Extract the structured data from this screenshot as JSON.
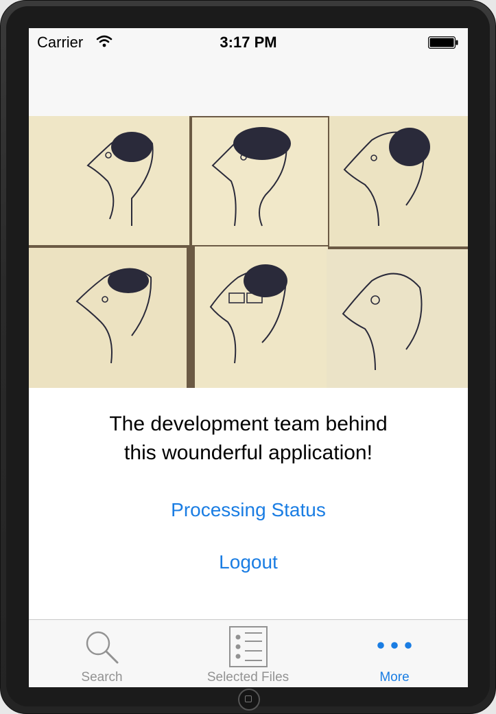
{
  "status_bar": {
    "carrier": "Carrier",
    "time": "3:17 PM"
  },
  "content": {
    "message_line1": "The development team behind",
    "message_line2": "this wounderful application!",
    "links": {
      "processing_status": "Processing Status",
      "logout": "Logout"
    }
  },
  "tab_bar": {
    "tabs": [
      {
        "label": "Search",
        "icon": "search-icon",
        "active": false
      },
      {
        "label": "Selected Files",
        "icon": "list-icon",
        "active": false
      },
      {
        "label": "More",
        "icon": "more-icon",
        "active": true
      }
    ]
  },
  "colors": {
    "accent": "#1a7de3",
    "inactive": "#929292",
    "paper": "#efe6c6"
  }
}
